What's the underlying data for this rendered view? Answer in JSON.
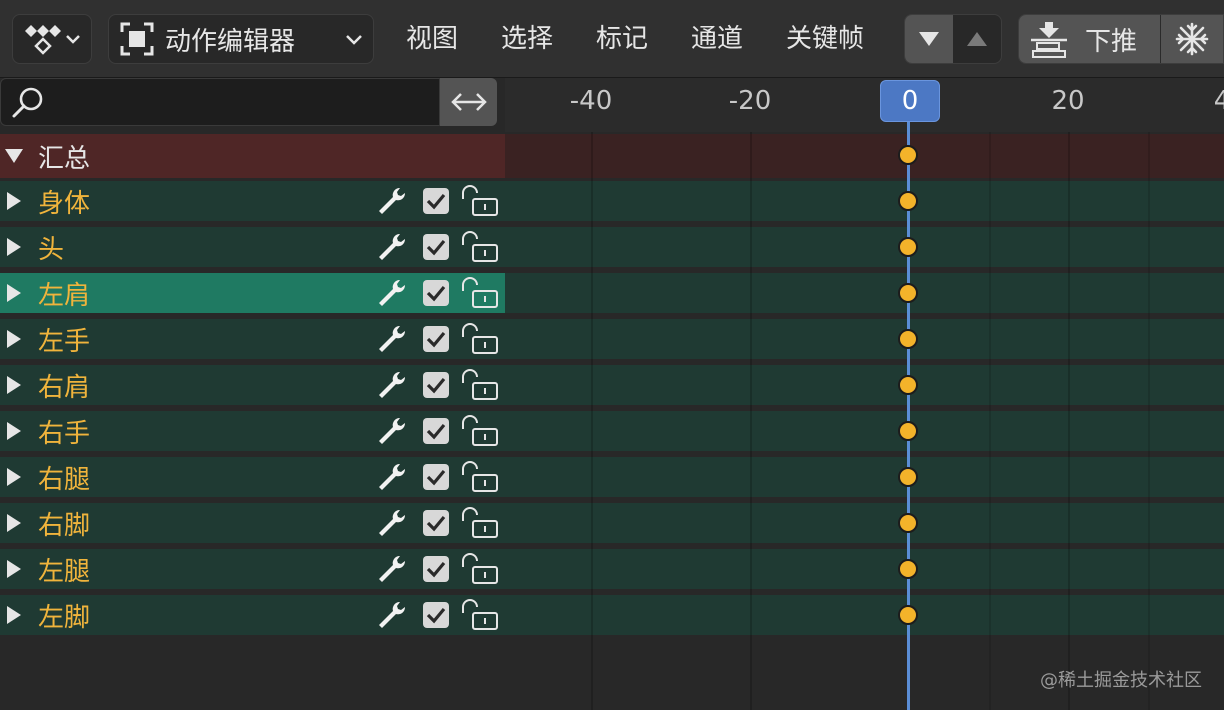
{
  "header": {
    "editor_type_label": "动作编辑器",
    "menus": [
      "视图",
      "选择",
      "标记",
      "通道",
      "关键帧"
    ],
    "push_down_label": "下推"
  },
  "search": {
    "placeholder": ""
  },
  "ruler": {
    "ticks": [
      "-40",
      "-20",
      "0",
      "20",
      "4"
    ],
    "current_frame": "0"
  },
  "summary": {
    "label": "汇总"
  },
  "channels": [
    {
      "label": "身体",
      "selected": false
    },
    {
      "label": "头",
      "selected": false
    },
    {
      "label": "左肩",
      "selected": true
    },
    {
      "label": "左手",
      "selected": false
    },
    {
      "label": "右肩",
      "selected": false
    },
    {
      "label": "右手",
      "selected": false
    },
    {
      "label": "右腿",
      "selected": false
    },
    {
      "label": "右脚",
      "selected": false
    },
    {
      "label": "左腿",
      "selected": false
    },
    {
      "label": "左脚",
      "selected": false
    }
  ],
  "watermark": "@稀土掘金技术社区",
  "colors": {
    "summary_row": "#4f2626",
    "channel_row": "#1f3a33",
    "selected_row": "#1f7a62",
    "keyframe": "#f3b32a",
    "playhead": "#4c78c4",
    "channel_text": "#f0b43c"
  }
}
